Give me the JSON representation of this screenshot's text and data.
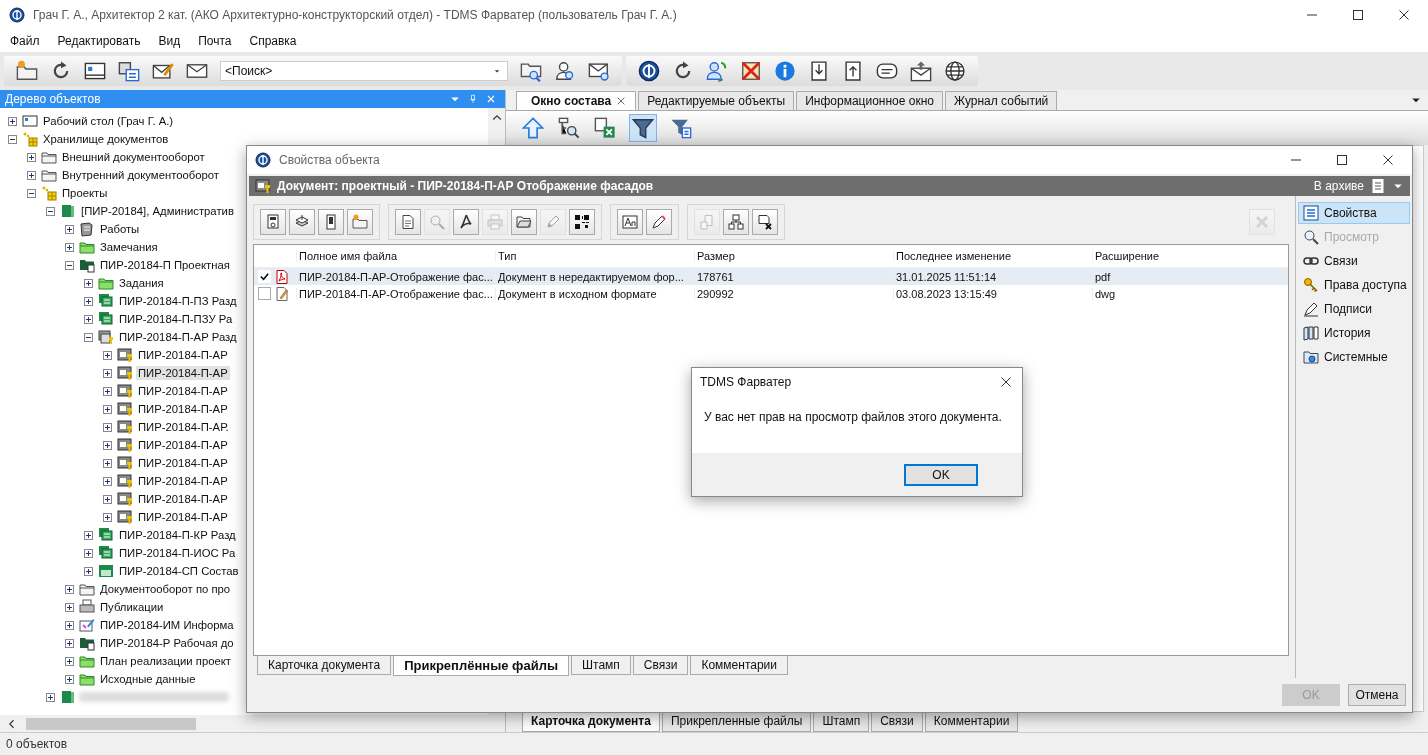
{
  "window": {
    "title": "Грач Г. А., Архитектор 2 кат. (АКО Архитектурно-конструкторский отдел) - TDMS Фарватер (пользователь Грач Г. А.)"
  },
  "menu": [
    "Файл",
    "Редактировать",
    "Вид",
    "Почта",
    "Справка"
  ],
  "search": {
    "value": "<Поиск>"
  },
  "tree_panel": {
    "title": "Дерево объектов",
    "items": [
      {
        "label": "Рабочий стол (Грач Г. А.)",
        "kind": "desktop",
        "expanded": false,
        "selected": false
      },
      {
        "label": "Хранилище документов",
        "kind": "storage",
        "expanded": true,
        "selected": false,
        "children": [
          {
            "label": "Внешний документооборот",
            "kind": "folder",
            "expanded": false,
            "selected": false
          },
          {
            "label": "Внутренний документооборот",
            "kind": "folder",
            "expanded": false,
            "selected": false
          },
          {
            "label": "Проекты",
            "kind": "storage",
            "expanded": true,
            "selected": false,
            "children": [
              {
                "label": "[ПИР-20184], Административ",
                "kind": "project",
                "expanded": true,
                "selected": false,
                "children": [
                  {
                    "label": "Работы",
                    "kind": "works",
                    "expanded": false,
                    "selected": false
                  },
                  {
                    "label": "Замечания",
                    "kind": "green-folder",
                    "expanded": false,
                    "selected": false
                  },
                  {
                    "label": "ПИР-20184-П Проектная",
                    "kind": "dark-folder",
                    "expanded": true,
                    "selected": false,
                    "children": [
                      {
                        "label": "Задания",
                        "kind": "green-folder",
                        "expanded": false,
                        "selected": false
                      },
                      {
                        "label": "ПИР-20184-П-ПЗ Разд",
                        "kind": "section",
                        "expanded": false,
                        "selected": false
                      },
                      {
                        "label": "ПИР-20184-П-ПЗУ Ра",
                        "kind": "section",
                        "expanded": false,
                        "selected": false
                      },
                      {
                        "label": "ПИР-20184-П-АР Разд",
                        "kind": "section-archived",
                        "expanded": true,
                        "selected": false,
                        "children": [
                          {
                            "label": "ПИР-20184-П-АР",
                            "kind": "document",
                            "expanded": false,
                            "selected": false
                          },
                          {
                            "label": "ПИР-20184-П-АР",
                            "kind": "document",
                            "expanded": false,
                            "selected": true
                          },
                          {
                            "label": "ПИР-20184-П-АР",
                            "kind": "document",
                            "expanded": false,
                            "selected": false
                          },
                          {
                            "label": "ПИР-20184-П-АР",
                            "kind": "document",
                            "expanded": false,
                            "selected": false
                          },
                          {
                            "label": "ПИР-20184-П-АР.",
                            "kind": "document",
                            "expanded": false,
                            "selected": false
                          },
                          {
                            "label": "ПИР-20184-П-АР",
                            "kind": "document",
                            "expanded": false,
                            "selected": false
                          },
                          {
                            "label": "ПИР-20184-П-АР",
                            "kind": "document",
                            "expanded": false,
                            "selected": false
                          },
                          {
                            "label": "ПИР-20184-П-АР",
                            "kind": "document",
                            "expanded": false,
                            "selected": false
                          },
                          {
                            "label": "ПИР-20184-П-АР",
                            "kind": "document",
                            "expanded": false,
                            "selected": false
                          },
                          {
                            "label": "ПИР-20184-П-АР",
                            "kind": "document",
                            "expanded": false,
                            "selected": false
                          }
                        ]
                      },
                      {
                        "label": "ПИР-20184-П-КР Разд",
                        "kind": "section",
                        "expanded": false,
                        "selected": false
                      },
                      {
                        "label": "ПИР-20184-П-ИОС Ра",
                        "kind": "section",
                        "expanded": false,
                        "selected": false
                      },
                      {
                        "label": "ПИР-20184-СП Состав",
                        "kind": "section-single",
                        "expanded": false,
                        "selected": false
                      }
                    ]
                  },
                  {
                    "label": "Документооборот по про",
                    "kind": "folder",
                    "expanded": false,
                    "selected": false
                  },
                  {
                    "label": "Публикации",
                    "kind": "publications",
                    "expanded": false,
                    "selected": false
                  },
                  {
                    "label": "ПИР-20184-ИМ Информа",
                    "kind": "model",
                    "expanded": false,
                    "selected": false
                  },
                  {
                    "label": "ПИР-20184-Р Рабочая до",
                    "kind": "dark-folder",
                    "expanded": false,
                    "selected": false
                  },
                  {
                    "label": "План реализации проект",
                    "kind": "green-folder",
                    "expanded": false,
                    "selected": false
                  },
                  {
                    "label": "Исходные данные",
                    "kind": "green-folder",
                    "expanded": false,
                    "selected": false
                  }
                ]
              },
              {
                "kind": "blurred",
                "expanded": false,
                "selected": false
              }
            ]
          }
        ]
      }
    ]
  },
  "tabs": [
    {
      "label": "Окно состава",
      "selected": true
    },
    {
      "label": "Редактируемые объекты",
      "selected": false
    },
    {
      "label": "Информационное окно",
      "selected": false
    },
    {
      "label": "Журнал событий",
      "selected": false
    }
  ],
  "bottom_tabs": [
    {
      "label": "Карточка документа",
      "selected": true
    },
    {
      "label": "Прикрепленные файлы",
      "selected": false
    },
    {
      "label": "Штамп",
      "selected": false
    },
    {
      "label": "Связи",
      "selected": false
    },
    {
      "label": "Комментарии",
      "selected": false
    }
  ],
  "status_bar": "0 объектов",
  "dialog": {
    "title": "Свойства объекта",
    "header": "Документ: проектный - ПИР-20184-П-АР Отображение фасадов",
    "status": "В архиве",
    "toolbar": [
      [
        {
          "disabled": false
        },
        {
          "disabled": false
        },
        {
          "disabled": false
        },
        {
          "disabled": false
        }
      ],
      [
        {
          "disabled": false
        },
        {
          "disabled": true
        },
        {
          "disabled": false
        },
        {
          "disabled": true
        },
        {
          "disabled": false
        },
        {
          "disabled": true
        },
        {
          "disabled": false
        }
      ],
      [
        {
          "disabled": false
        },
        {
          "disabled": false
        }
      ],
      [
        {
          "disabled": true
        },
        {
          "disabled": false
        },
        {
          "disabled": false
        }
      ]
    ],
    "clear_button": {
      "disabled": true
    },
    "columns": [
      "Полное имя файла",
      "Тип",
      "Размер",
      "Последнее изменение",
      "Расширение"
    ],
    "rows": [
      {
        "kind": "pdf",
        "checked": true,
        "selected": true,
        "name": "ПИР-20184-П-АР-Отображение фас...",
        "type": "Документ в нередактируемом фор...",
        "size": "178761",
        "modified": "31.01.2025 11:51:14",
        "extension": "pdf"
      },
      {
        "kind": "dwg",
        "checked": false,
        "selected": false,
        "name": "ПИР-20184-П-АР-Отображение фас...",
        "type": "Документ в исходном формате",
        "size": "290992",
        "modified": "03.08.2023 13:15:49",
        "extension": "dwg"
      }
    ],
    "tabs": [
      {
        "label": "Карточка документа",
        "selected": false
      },
      {
        "label": "Прикреплённые файлы",
        "selected": true
      },
      {
        "label": "Штамп",
        "selected": false
      },
      {
        "label": "Связи",
        "selected": false
      },
      {
        "label": "Комментарии",
        "selected": false
      }
    ],
    "side_items": [
      {
        "label": "Свойства",
        "selected": true,
        "disabled": false
      },
      {
        "label": "Просмотр",
        "selected": false,
        "disabled": true
      },
      {
        "label": "Связи",
        "selected": false,
        "disabled": false
      },
      {
        "label": "Права доступа",
        "selected": false,
        "disabled": false
      },
      {
        "label": "Подписи",
        "selected": false,
        "disabled": false
      },
      {
        "label": "История",
        "selected": false,
        "disabled": false
      },
      {
        "label": "Системные",
        "selected": false,
        "disabled": false
      }
    ],
    "buttons": [
      {
        "label": "OK",
        "disabled": true
      },
      {
        "label": "Отмена",
        "disabled": false
      }
    ]
  },
  "message_box": {
    "title": "TDMS Фарватер",
    "text": "У вас нет прав на просмотр файлов этого документа.",
    "button": "OK"
  }
}
